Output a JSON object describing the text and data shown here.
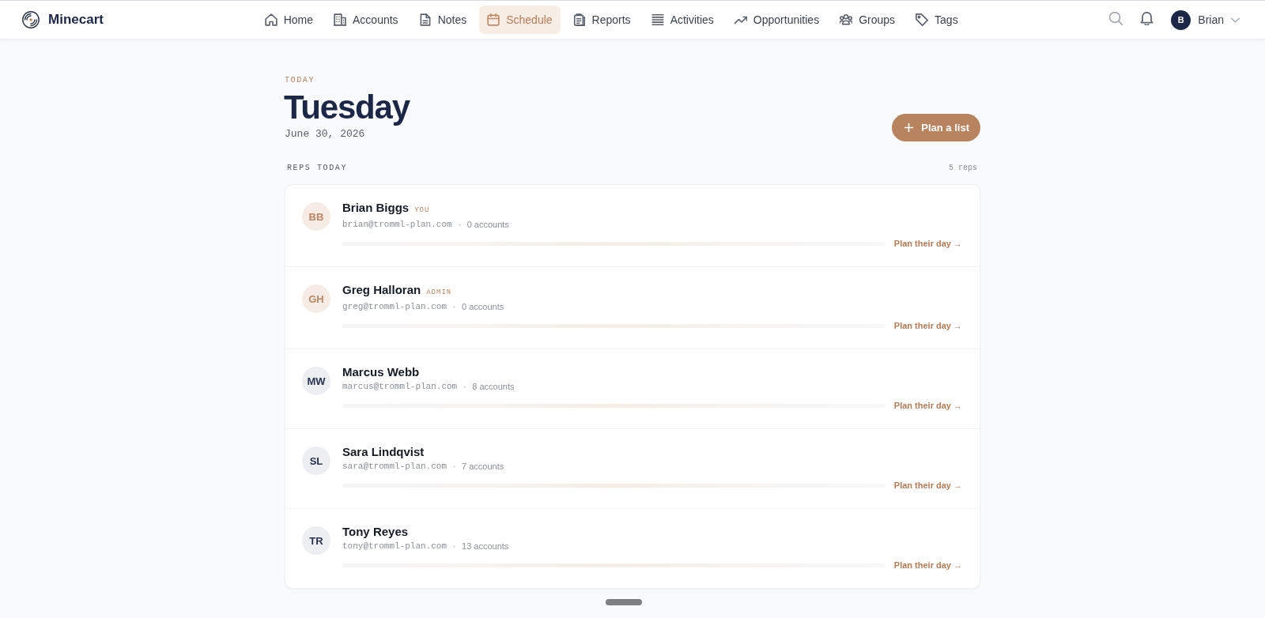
{
  "app": {
    "name": "Minecart"
  },
  "nav": [
    {
      "label": "Home",
      "selected": false
    },
    {
      "label": "Accounts",
      "selected": false
    },
    {
      "label": "Notes",
      "selected": false
    },
    {
      "label": "Schedule",
      "selected": true
    },
    {
      "label": "Reports",
      "selected": false
    },
    {
      "label": "Activities",
      "selected": false
    },
    {
      "label": "Opportunities",
      "selected": false
    },
    {
      "label": "Groups",
      "selected": false
    },
    {
      "label": "Tags",
      "selected": false
    }
  ],
  "user": {
    "initial": "B",
    "name": "Brian"
  },
  "header": {
    "eyebrow": "TODAY",
    "title": "Tuesday",
    "date": "June 30, 2026",
    "action": "Plan a list"
  },
  "section": {
    "title": "REPS TODAY",
    "count": "5 reps"
  },
  "reps": [
    {
      "initials": "BB",
      "name": "Brian Biggs",
      "badge": "YOU",
      "email": "brian@tromml-plan.com",
      "accounts": "0 accounts",
      "highlighted": true,
      "link": "Plan their day →"
    },
    {
      "initials": "GH",
      "name": "Greg Halloran",
      "badge": "ADMIN",
      "email": "greg@tromml-plan.com",
      "accounts": "0 accounts",
      "highlighted": true,
      "link": "Plan their day →"
    },
    {
      "initials": "MW",
      "name": "Marcus Webb",
      "email": "marcus@tromml-plan.com",
      "accounts": "8 accounts",
      "highlighted": false,
      "link": "Plan their day →"
    },
    {
      "initials": "SL",
      "name": "Sara Lindqvist",
      "email": "sara@tromml-plan.com",
      "accounts": "7 accounts",
      "highlighted": false,
      "link": "Plan their day →"
    },
    {
      "initials": "TR",
      "name": "Tony Reyes",
      "email": "tony@tromml-plan.com",
      "accounts": "13 accounts",
      "highlighted": false,
      "link": "Plan their day →"
    }
  ]
}
